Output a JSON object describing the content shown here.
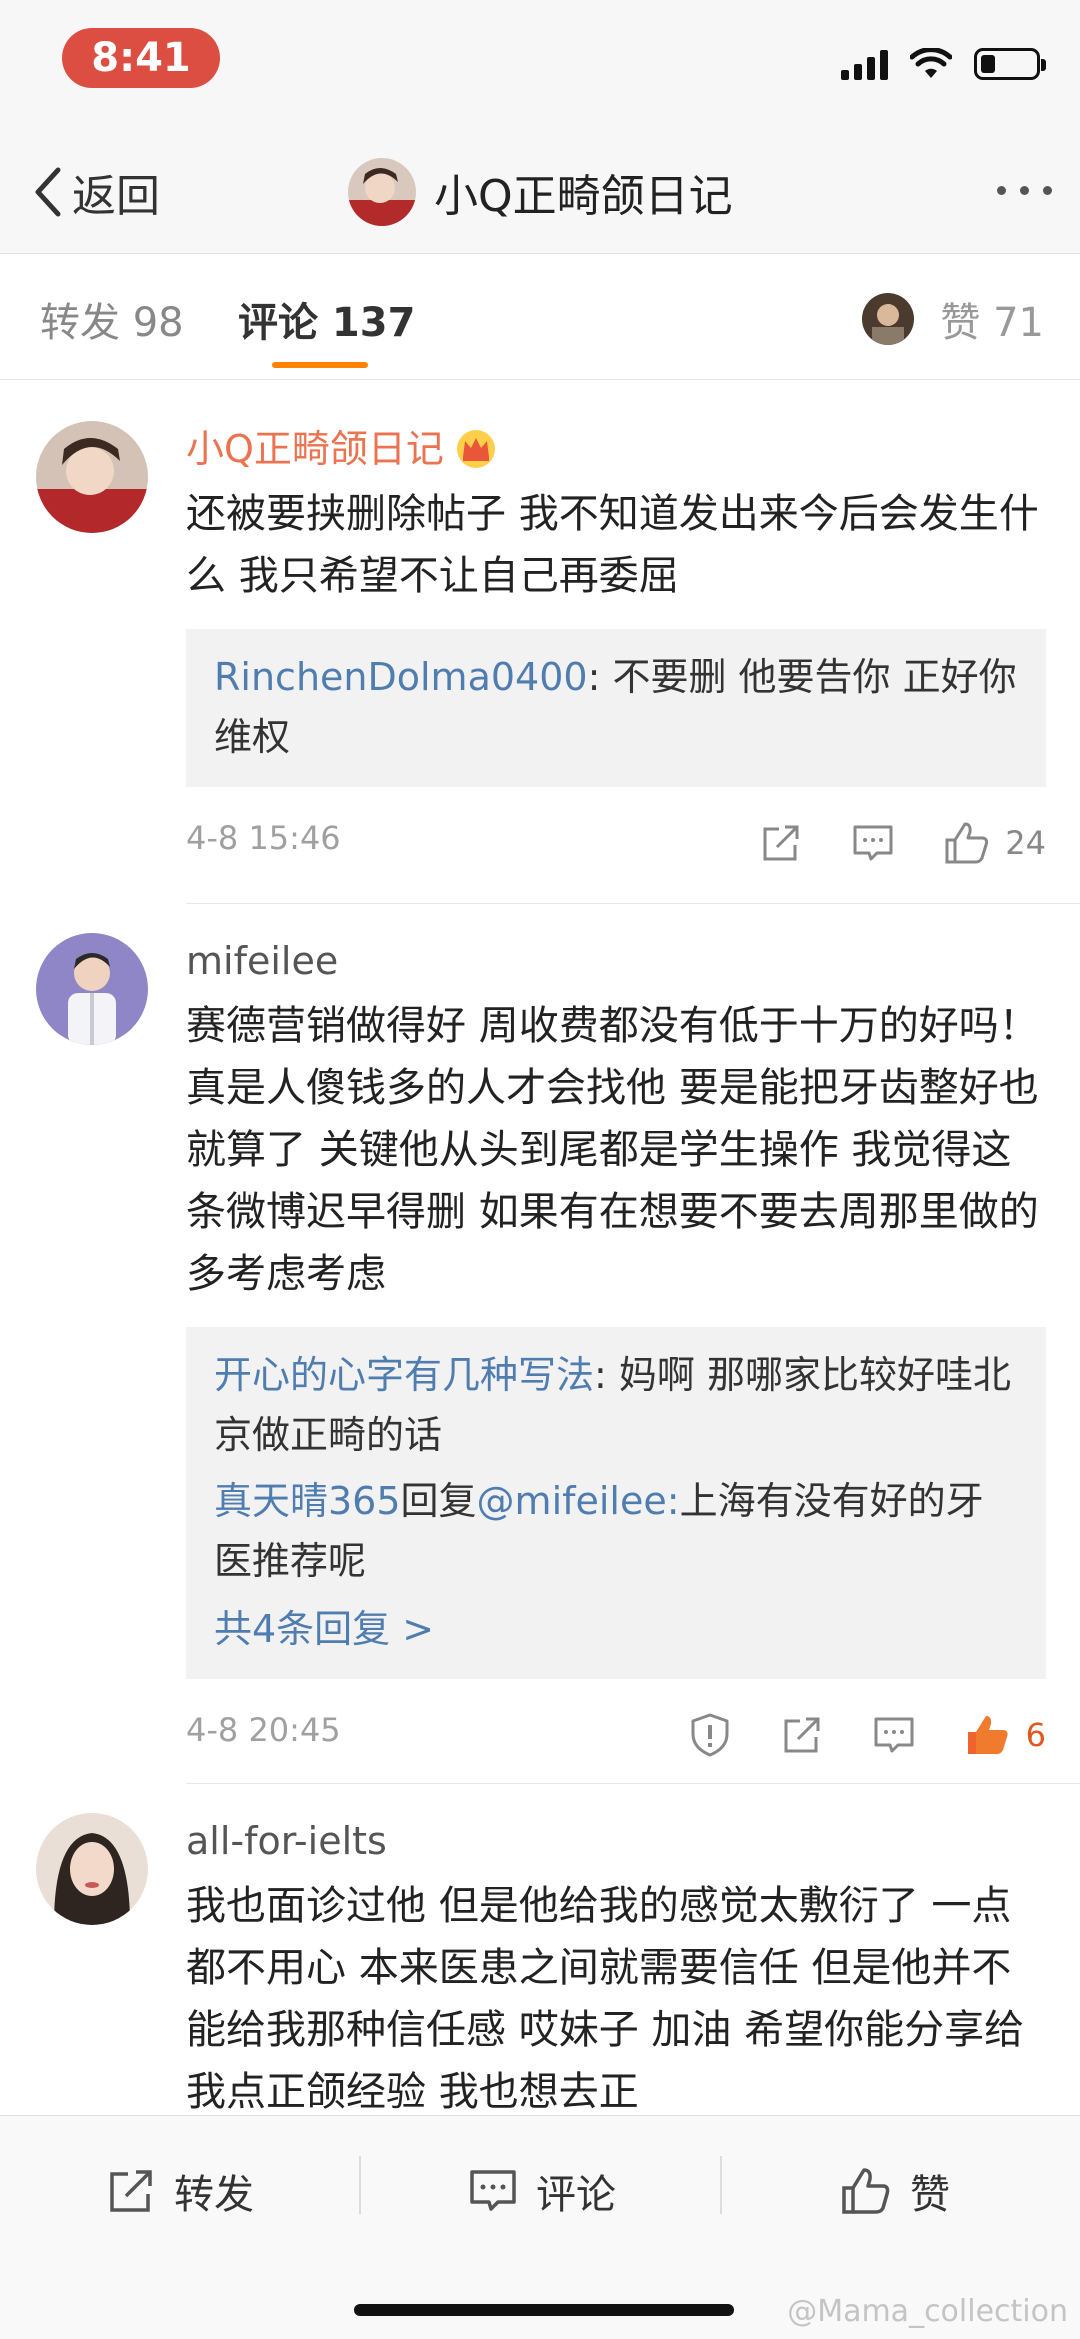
{
  "status_bar": {
    "time": "8:41"
  },
  "nav": {
    "back_label": "返回",
    "title": "小Q正畸颌日记"
  },
  "tabs": [
    {
      "label": "转发 98"
    },
    {
      "label": "评论 137",
      "active": true
    },
    {
      "label": "赞 71"
    }
  ],
  "comments": [
    {
      "username": "小Q正畸颌日记",
      "badge": "crown-icon",
      "text": "还被要挟删除帖子 我不知道发出来今后会发生什么 我只希望不让自己再委屈",
      "replies": [
        {
          "user": "RinchenDolma0400",
          "text": ": 不要删 他要告你 正好你维权"
        }
      ],
      "date": "4-8 15:46",
      "likes": "24"
    },
    {
      "username": "mifeilee",
      "text": "赛德营销做得好 周收费都没有低于十万的好吗！真是人傻钱多的人才会找他 要是能把牙齿整好也就算了 关键他从头到尾都是学生操作  我觉得这条微博迟早得删 如果有在想要不要去周那里做的 多考虑考虑",
      "replies": [
        {
          "user": "开心的心字有几种写法",
          "text": ": 妈啊 那哪家比较好哇北京做正畸的话"
        },
        {
          "user": "真天晴365",
          "mid": "回复",
          "mention": "@mifeilee:",
          "text": "上海有没有好的牙医推荐呢"
        }
      ],
      "more_replies": "共4条回复 >",
      "date": "4-8 20:45",
      "likes": "6"
    },
    {
      "username": "all-for-ielts",
      "text": "我也面诊过他 但是他给我的感觉太敷衍了 一点都不用心 本来医患之间就需要信任 但是他并不能给我那种信任感 哎妹子 加油 希望你能分享给我点正颌经验 我也想去正"
    }
  ],
  "bottom_bar": {
    "repost_label": "转发",
    "comment_label": "评论",
    "like_label": "赞"
  },
  "watermark": "@Mama_collection",
  "colors": {
    "accent_orange": "#ff8200",
    "owner_name": "#eb7350",
    "link_blue": "#507daf",
    "time_pill": "#dc4e41"
  }
}
